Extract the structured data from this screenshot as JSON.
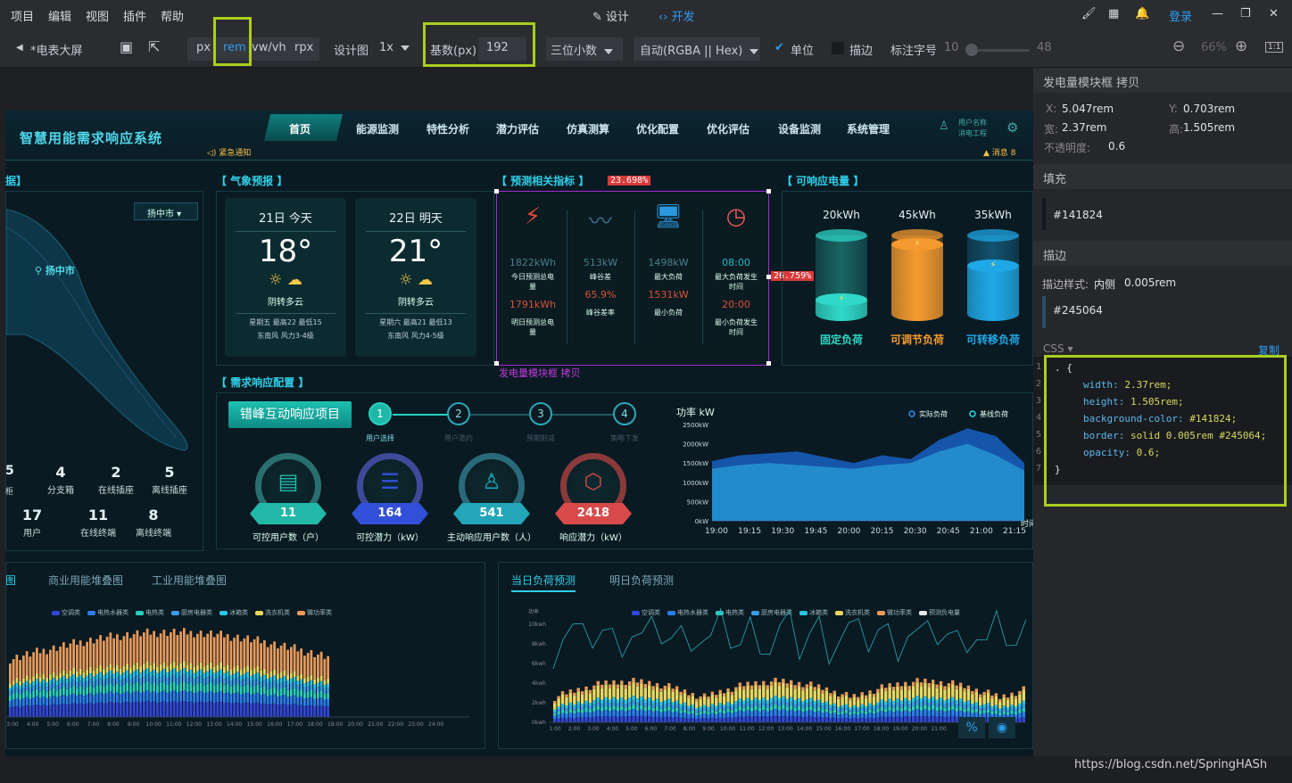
{
  "menu": {
    "items": [
      "项目",
      "编辑",
      "视图",
      "插件",
      "帮助"
    ],
    "design": "设计",
    "dev": "开发",
    "login": "登录"
  },
  "toolbar": {
    "page_name": "*电表大屏",
    "units": [
      "px",
      "rem",
      "vw/vh",
      "rpx"
    ],
    "design_label": "设计图",
    "scale": "1x",
    "base_label": "基数(px)",
    "base_value": "192",
    "decimals": "三位小数",
    "color_mode": "自动(RGBA || Hex)",
    "unit_label": "单位",
    "stroke_label": "描边",
    "font_label": "标注字号",
    "font_min": "10",
    "font_max": "48",
    "zoom": "66%"
  },
  "right_panel": {
    "title": "发电量模块框 拷贝",
    "x_label": "X:",
    "x_value": "5.047rem",
    "y_label": "Y:",
    "y_value": "0.703rem",
    "w_label": "宽:",
    "w_value": "2.37rem",
    "h_label": "高:",
    "h_value": "1.505rem",
    "opacity_label": "不透明度:",
    "opacity_value": "0.6",
    "fill_label": "填充",
    "fill_value": "#141824",
    "fill_color": "#141824",
    "stroke_label": "描边",
    "stroke_style_label": "描边样式:",
    "stroke_style": "内侧",
    "stroke_width": "0.005rem",
    "stroke_value": "#245064",
    "stroke_color": "#245064",
    "css_label": "CSS",
    "copy_label": "复制",
    "code_lines": [
      ". {",
      "width: 2.37rem;",
      "height: 1.505rem;",
      "background-color: #141824;",
      "border: solid 0.005rem #245064;",
      "opacity: 0.6;",
      "}"
    ],
    "line_numbers": [
      "1",
      "2",
      "3",
      "4",
      "5",
      "6",
      "7"
    ]
  },
  "dashboard": {
    "title": "智慧用能需求响应系统",
    "notice": "紧急通知",
    "nav": [
      "首页",
      "能源监测",
      "特性分析",
      "潜力评估",
      "仿真测算",
      "优化配置",
      "优化评估",
      "设备监测",
      "系统管理"
    ],
    "user": {
      "name": "用户名称",
      "company": "消电工程"
    },
    "messages": {
      "label": "消息",
      "count": "8"
    },
    "left_title": "据】",
    "city_select": "扬中市",
    "city_pin": "扬中市",
    "left_stats": [
      {
        "v": "4",
        "l": "分支箱"
      },
      {
        "v": "2",
        "l": "在线插座"
      },
      {
        "v": "5",
        "l": "离线插座"
      },
      {
        "v": "17",
        "l": "用户"
      },
      {
        "v": "11",
        "l": "在线终端"
      },
      {
        "v": "8",
        "l": "离线终端"
      }
    ],
    "left_partial": [
      "柜",
      "5"
    ],
    "weather_title": "【 气象预报 】",
    "weather": [
      {
        "date": "21日",
        "day": "今天",
        "temp": "18°",
        "desc": "阴转多云",
        "week": "星期五",
        "high": "最高22",
        "low": "最低15",
        "wind": "东南风  风力3-4级"
      },
      {
        "date": "22日",
        "day": "明天",
        "temp": "21°",
        "desc": "阴转多云",
        "week": "星期六",
        "high": "最高21",
        "low": "最低13",
        "wind": "东南风  风力4-5级"
      }
    ],
    "predict_title": "【 预测相关指标 】",
    "predict_badge1": "23.698%",
    "predict_badge2": "26.759%",
    "selection_label": "发电量模块框 拷贝",
    "predict_items": [
      {
        "v1": "1822kWh",
        "l1": "今日预测总电量",
        "v2": "1791kWh",
        "l2": "明日预测总电量",
        "c1": "#4a7f8c",
        "c2": "#d9513a"
      },
      {
        "v1": "513kW",
        "l1": "峰谷差",
        "v2": "65.9%",
        "l2": "峰谷差率",
        "c1": "#4a7f8c",
        "c2": "#d9513a"
      },
      {
        "v1": "1498kW",
        "l1": "最大负荷",
        "v2": "1531kW",
        "l2": "最小负荷",
        "c1": "#4a7f8c",
        "c2": "#d9513a"
      },
      {
        "v1": "08:00",
        "l1": "最大负荷发生时间",
        "v2": "20:00",
        "l2": "最小负荷发生时间",
        "c1": "#2ab8c7",
        "c2": "#d9513a"
      }
    ],
    "response_title": "【 可响应电量 】",
    "response": [
      {
        "v": "20kWh",
        "l": "固定负荷",
        "color": "#2fd8c8",
        "level": 0.25
      },
      {
        "v": "45kWh",
        "l": "可调节负荷",
        "color": "#f59a2e",
        "level": 0.9
      },
      {
        "v": "35kWh",
        "l": "可转移负荷",
        "color": "#1fa8e6",
        "level": 0.65
      }
    ],
    "config_title": "【 需求响应配置 】",
    "project_btn": "错峰互动响应项目",
    "steps": [
      {
        "n": "1",
        "l": "用户选择"
      },
      {
        "n": "2",
        "l": "用户邀约"
      },
      {
        "n": "3",
        "l": "预期削减"
      },
      {
        "n": "4",
        "l": "策略下发"
      }
    ],
    "gauges": [
      {
        "v": "11",
        "l": "可控用户数（户）",
        "color": "#22b8a8",
        "ring": "#2a6f6f"
      },
      {
        "v": "164",
        "l": "可控潜力（kW）",
        "color": "#3350d8",
        "ring": "#404a9a"
      },
      {
        "v": "541",
        "l": "主动响应用户数（人）",
        "color": "#22a6b8",
        "ring": "#2a6a7a"
      },
      {
        "v": "2418",
        "l": "响应潜力（kW）",
        "color": "#d84a4a",
        "ring": "#8a3a3a"
      }
    ],
    "area_chart": {
      "y_unit": "功率 kW",
      "x_unit": "时间",
      "legend": [
        "实际负荷",
        "基线负荷"
      ]
    },
    "bottom_left_tabs": [
      "图",
      "商业用能堆叠图",
      "工业用能堆叠图"
    ],
    "bottom_left_legend": [
      "空调类",
      "电热水器类",
      "电热类",
      "厨房电器类",
      "冰箱类",
      "洗衣机类",
      "微功率类"
    ],
    "bottom_left_x": [
      "3:00",
      "4:00",
      "5:00",
      "6:00",
      "7:00",
      "8:00",
      "9:00",
      "10:00",
      "11:00",
      "12:00",
      "13:00",
      "14:00",
      "15:00",
      "16:00",
      "17:00",
      "18:00",
      "19:00",
      "20:00",
      "21:00",
      "22:00",
      "23:00",
      "24:00"
    ],
    "bottom_right_tabs": [
      "当日负荷预测",
      "明日负荷预测"
    ],
    "bottom_right_legend": [
      "空调类",
      "电热水器类",
      "电热类",
      "厨房电器类",
      "冰箱类",
      "洗衣机类",
      "微功率类",
      "预测负电量"
    ],
    "bottom_right_y": [
      "10kwh",
      "8kwh",
      "6kwh",
      "4kwh",
      "2kwh",
      "0kwh"
    ],
    "bottom_right_yunit": "功率",
    "bottom_right_x": [
      "1:00",
      "2:00",
      "3:00",
      "4:00",
      "5:00",
      "6:00",
      "7:00",
      "8:00",
      "9:00",
      "10:00",
      "11:00",
      "12:00",
      "13:00",
      "14:00",
      "15:00",
      "16:00",
      "17:00",
      "18:00",
      "19:00",
      "20:00",
      "21:00"
    ]
  },
  "watermark": "https://blog.csdn.net/SpringHASh",
  "chart_data": [
    {
      "type": "area",
      "title": "",
      "ylabel": "功率 kW",
      "xlabel": "时间",
      "categories": [
        "19:00",
        "19:15",
        "19:30",
        "19:45",
        "20:00",
        "20:15",
        "20:30",
        "20:45",
        "21:00",
        "21:15"
      ],
      "yticks": [
        "2500kW",
        "2000kW",
        "1500kW",
        "1000kW",
        "500kW",
        "0kW"
      ],
      "ylim": [
        0,
        2500
      ],
      "series": [
        {
          "name": "实际负荷",
          "values": [
            1550,
            1700,
            1750,
            1800,
            1650,
            1500,
            1700,
            1600,
            2100,
            2400,
            2200,
            1500
          ]
        },
        {
          "name": "基线负荷",
          "values": [
            1350,
            1450,
            1500,
            1450,
            1400,
            1350,
            1450,
            1500,
            1800,
            2000,
            1700,
            1300
          ]
        }
      ]
    }
  ]
}
